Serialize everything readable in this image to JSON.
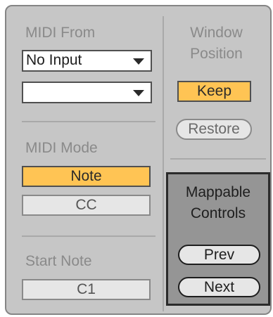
{
  "midi_from": {
    "label": "MIDI From",
    "input_select": "No Input",
    "channel_select": ""
  },
  "midi_mode": {
    "label": "MIDI Mode",
    "options": [
      "Note",
      "CC"
    ],
    "selected": "Note"
  },
  "start_note": {
    "label": "Start Note",
    "value": "C1"
  },
  "window_position": {
    "label_line1": "Window",
    "label_line2": "Position",
    "keep_label": "Keep",
    "restore_label": "Restore"
  },
  "mappable_controls": {
    "title_line1": "Mappable",
    "title_line2": "Controls",
    "prev_label": "Prev",
    "next_label": "Next"
  },
  "colors": {
    "panel_bg": "#c6c6c6",
    "active_accent": "#ffc454",
    "mapping_box_bg": "#959595"
  }
}
